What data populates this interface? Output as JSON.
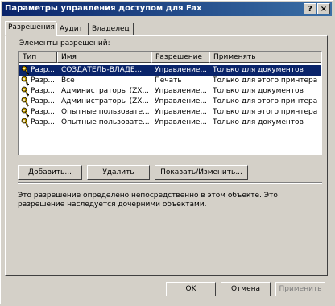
{
  "window": {
    "title": "Параметры управления доступом для Fax",
    "help_glyph": "?",
    "close_glyph": "×"
  },
  "tabs": [
    {
      "label": "Разрешения"
    },
    {
      "label": "Аудит"
    },
    {
      "label": "Владелец"
    }
  ],
  "permissions": {
    "group_label": "Элементы разрешений:",
    "columns": [
      "Тип",
      "Имя",
      "Разрешение",
      "Применять"
    ],
    "rows": [
      {
        "type": "Разр...",
        "name": "СОЗДАТЕЛЬ-ВЛАДЕ...",
        "permission": "Управление...",
        "apply": "Только для документов",
        "selected": true
      },
      {
        "type": "Разр...",
        "name": "Все",
        "permission": "Печать",
        "apply": "Только для этого принтера",
        "selected": false
      },
      {
        "type": "Разр...",
        "name": "Администраторы (ZX...",
        "permission": "Управление...",
        "apply": "Только для документов",
        "selected": false
      },
      {
        "type": "Разр...",
        "name": "Администраторы (ZX...",
        "permission": "Управление...",
        "apply": "Только для этого принтера",
        "selected": false
      },
      {
        "type": "Разр...",
        "name": "Опытные пользовате...",
        "permission": "Управление...",
        "apply": "Только для этого принтера",
        "selected": false
      },
      {
        "type": "Разр...",
        "name": "Опытные пользовате...",
        "permission": "Управление...",
        "apply": "Только для документов",
        "selected": false
      }
    ],
    "add_button": "Добавить...",
    "remove_button": "Удалить",
    "view_button": "Показать/Изменить...",
    "info_text": "Это разрешение определено непосредственно в этом объекте. Это разрешение наследуется дочерними объектами."
  },
  "footer": {
    "ok": "OK",
    "cancel": "Отмена",
    "apply": "Применить"
  },
  "colors": {
    "selection": "#0a246a",
    "face": "#d4d0c8"
  }
}
